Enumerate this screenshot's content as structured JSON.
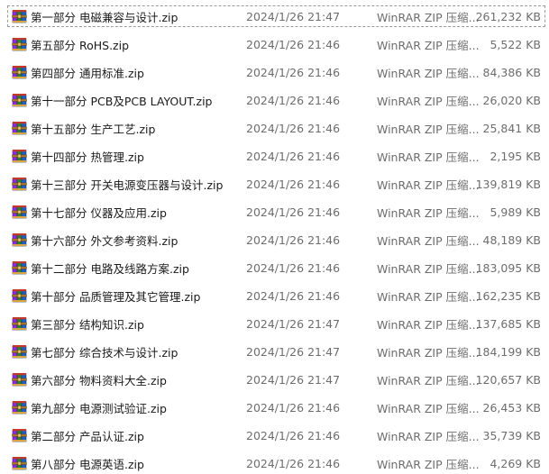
{
  "files": [
    {
      "name": "第一部分 电磁兼容与设计.zip",
      "date": "2024/1/26 21:47",
      "type": "WinRAR ZIP 压缩...",
      "size": "261,232 KB",
      "selected": true
    },
    {
      "name": "第五部分 RoHS.zip",
      "date": "2024/1/26 21:46",
      "type": "WinRAR ZIP 压缩...",
      "size": "5,522 KB"
    },
    {
      "name": "第四部分 通用标准.zip",
      "date": "2024/1/26 21:46",
      "type": "WinRAR ZIP 压缩...",
      "size": "84,386 KB"
    },
    {
      "name": "第十一部分 PCB及PCB LAYOUT.zip",
      "date": "2024/1/26 21:46",
      "type": "WinRAR ZIP 压缩...",
      "size": "26,020 KB"
    },
    {
      "name": "第十五部分 生产工艺.zip",
      "date": "2024/1/26 21:46",
      "type": "WinRAR ZIP 压缩...",
      "size": "25,841 KB"
    },
    {
      "name": "第十四部分 热管理.zip",
      "date": "2024/1/26 21:46",
      "type": "WinRAR ZIP 压缩...",
      "size": "2,195 KB"
    },
    {
      "name": "第十三部分 开关电源变压器与设计.zip",
      "date": "2024/1/26 21:46",
      "type": "WinRAR ZIP 压缩...",
      "size": "139,819 KB"
    },
    {
      "name": "第十七部分 仪器及应用.zip",
      "date": "2024/1/26 21:46",
      "type": "WinRAR ZIP 压缩...",
      "size": "5,989 KB"
    },
    {
      "name": "第十六部分 外文参考资料.zip",
      "date": "2024/1/26 21:46",
      "type": "WinRAR ZIP 压缩...",
      "size": "48,189 KB"
    },
    {
      "name": "第十二部分 电路及线路方案.zip",
      "date": "2024/1/26 21:46",
      "type": "WinRAR ZIP 压缩...",
      "size": "183,095 KB"
    },
    {
      "name": "第十部分 品质管理及其它管理.zip",
      "date": "2024/1/26 21:46",
      "type": "WinRAR ZIP 压缩...",
      "size": "162,235 KB"
    },
    {
      "name": "第三部分 结构知识.zip",
      "date": "2024/1/26 21:47",
      "type": "WinRAR ZIP 压缩...",
      "size": "137,685 KB"
    },
    {
      "name": "第七部分 综合技术与设计.zip",
      "date": "2024/1/26 21:47",
      "type": "WinRAR ZIP 压缩...",
      "size": "184,199 KB"
    },
    {
      "name": "第六部分 物料资料大全.zip",
      "date": "2024/1/26 21:47",
      "type": "WinRAR ZIP 压缩...",
      "size": "120,657 KB"
    },
    {
      "name": "第九部分 电源测试验证.zip",
      "date": "2024/1/26 21:46",
      "type": "WinRAR ZIP 压缩...",
      "size": "26,453 KB"
    },
    {
      "name": "第二部分 产品认证.zip",
      "date": "2024/1/26 21:46",
      "type": "WinRAR ZIP 压缩...",
      "size": "35,739 KB"
    },
    {
      "name": "第八部分 电源英语.zip",
      "date": "2024/1/26 21:46",
      "type": "WinRAR ZIP 压缩...",
      "size": "4,269 KB"
    }
  ],
  "icon": "winrar-archive-icon",
  "colors": {
    "name_text": "#1a1a1a",
    "meta_text": "#6d6d6d",
    "selection_border": "#9a9a9a"
  }
}
